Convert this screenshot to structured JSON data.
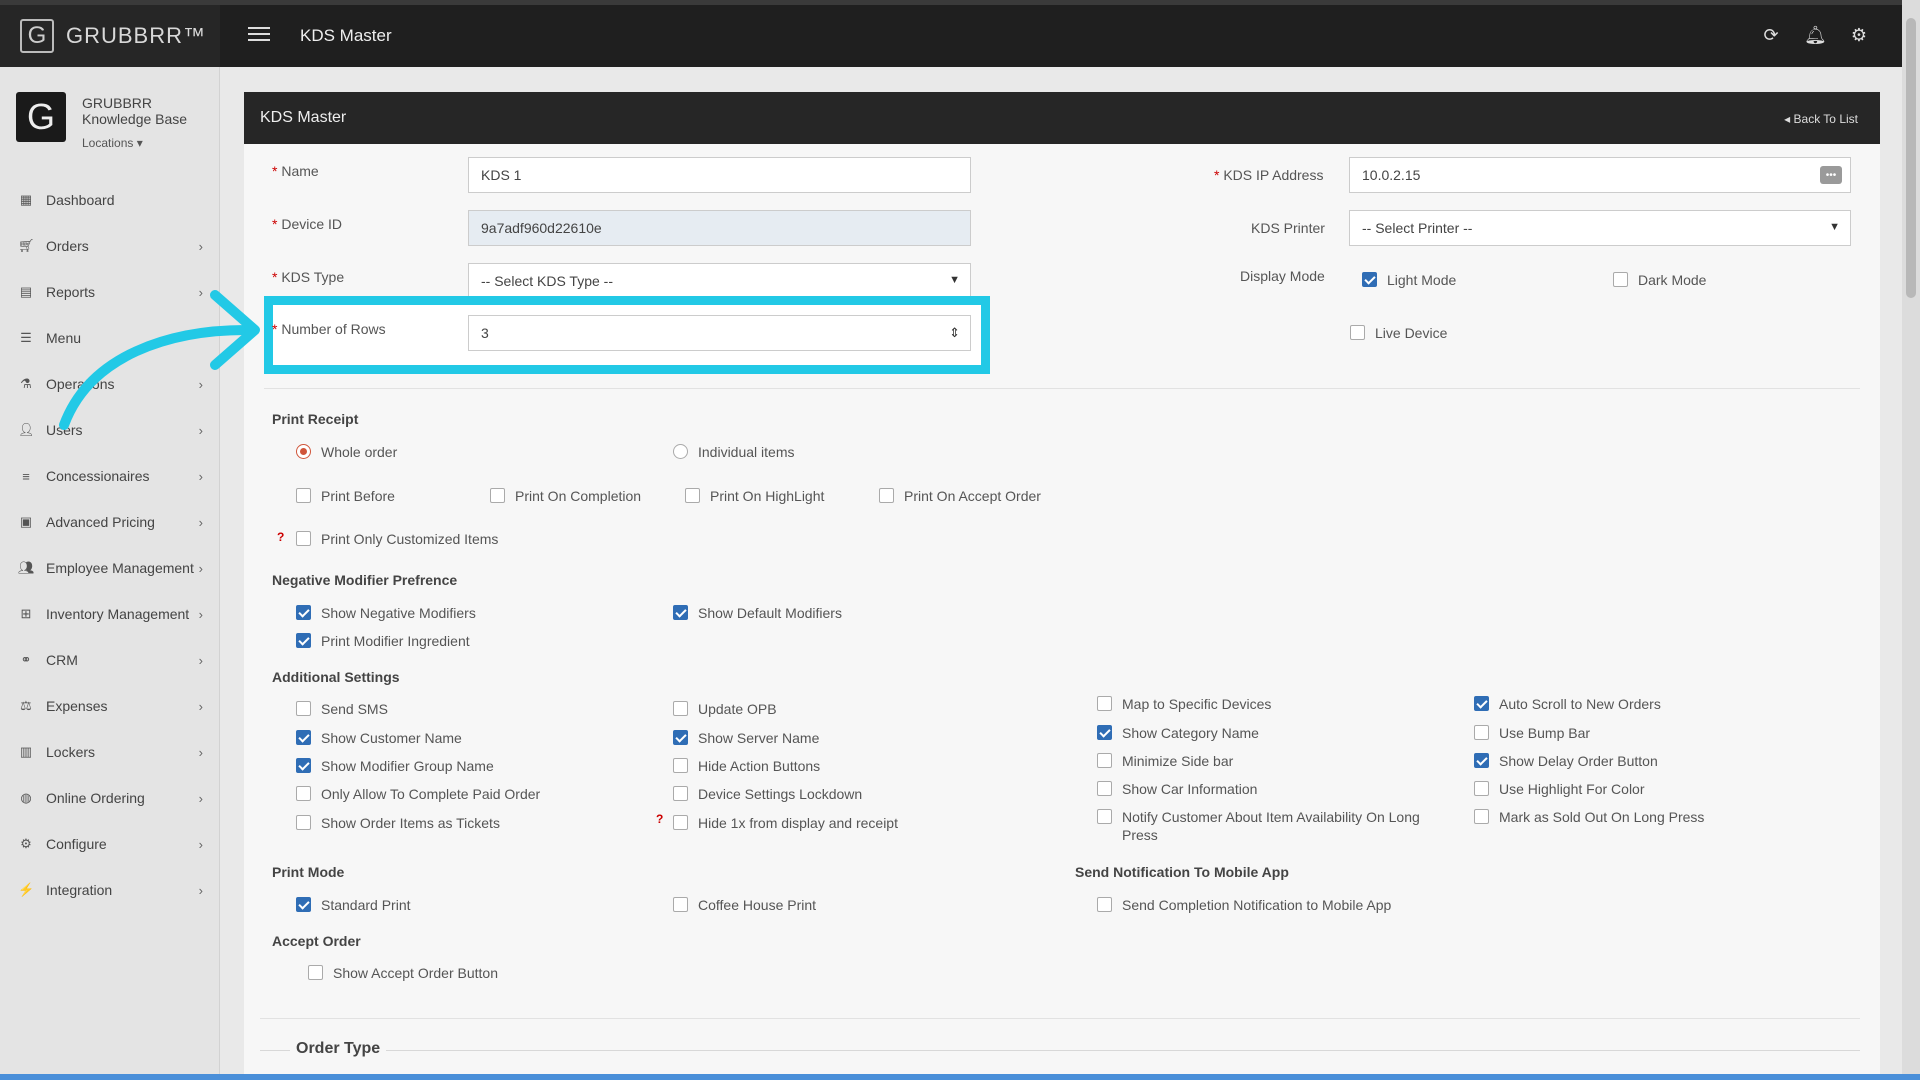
{
  "brand": {
    "logo_letter": "G",
    "name": "GRUBBRR™"
  },
  "header": {
    "title": "KDS Master"
  },
  "sidebar": {
    "profile_name": "GRUBBRR Knowledge Base",
    "profile_initial": "G",
    "locations": "Locations",
    "items": [
      {
        "label": "Dashboard",
        "icon": "dashboard-icon"
      },
      {
        "label": "Orders",
        "icon": "cart-icon"
      },
      {
        "label": "Reports",
        "icon": "report-icon"
      },
      {
        "label": "Menu",
        "icon": "menu-icon"
      },
      {
        "label": "Operations",
        "icon": "flask-icon"
      },
      {
        "label": "Users",
        "icon": "users-icon"
      },
      {
        "label": "Concessionaires",
        "icon": "list-icon"
      },
      {
        "label": "Advanced Pricing",
        "icon": "pricing-icon"
      },
      {
        "label": "Employee Management",
        "icon": "group-icon"
      },
      {
        "label": "Inventory Management",
        "icon": "sitemap-icon"
      },
      {
        "label": "CRM",
        "icon": "link-icon"
      },
      {
        "label": "Expenses",
        "icon": "scale-icon"
      },
      {
        "label": "Lockers",
        "icon": "lockers-icon"
      },
      {
        "label": "Online Ordering",
        "icon": "globe-icon"
      },
      {
        "label": "Configure",
        "icon": "gear-icon"
      },
      {
        "label": "Integration",
        "icon": "integration-icon"
      }
    ]
  },
  "panel": {
    "title": "KDS Master",
    "back_label": "Back To List"
  },
  "form": {
    "name_label": "Name",
    "name_value": "KDS 1",
    "device_id_label": "Device ID",
    "device_id_value": "9a7adf960d22610e",
    "kds_type_label": "KDS Type",
    "kds_type_value": "-- Select KDS Type --",
    "rows_label": "Number of Rows",
    "rows_value": "3",
    "ip_label": "KDS IP Address",
    "ip_value": "10.0.2.15",
    "printer_label": "KDS Printer",
    "printer_value": "-- Select Printer --",
    "display_mode_label": "Display Mode",
    "light_mode": "Light Mode",
    "dark_mode": "Dark Mode",
    "live_device": "Live Device"
  },
  "print_receipt": {
    "title": "Print Receipt",
    "whole_order": "Whole order",
    "individual_items": "Individual items",
    "print_before": "Print Before",
    "print_on_completion": "Print On Completion",
    "print_on_highlight": "Print On HighLight",
    "print_on_accept": "Print On Accept Order",
    "print_only_customized": "Print Only Customized Items"
  },
  "negative_modifier": {
    "title": "Negative Modifier Prefrence",
    "show_negative": "Show Negative Modifiers",
    "show_default": "Show Default Modifiers",
    "print_ingredient": "Print Modifier Ingredient"
  },
  "additional": {
    "title": "Additional Settings",
    "send_sms": "Send SMS",
    "update_opb": "Update OPB",
    "map_devices": "Map to Specific Devices",
    "auto_scroll": "Auto Scroll to New Orders",
    "show_customer": "Show Customer Name",
    "show_server": "Show Server Name",
    "show_category": "Show Category Name",
    "bump_bar": "Use Bump Bar",
    "show_modifier_group": "Show Modifier Group Name",
    "hide_action": "Hide Action Buttons",
    "minimize_side": "Minimize Side bar",
    "show_delay": "Show Delay Order Button",
    "only_paid": "Only Allow To Complete Paid Order",
    "device_lockdown": "Device Settings Lockdown",
    "show_car": "Show Car Information",
    "highlight_color": "Use Highlight For Color",
    "order_tickets": "Show Order Items as Tickets",
    "hide_1x": "Hide 1x from display and receipt",
    "notify_customer": "Notify Customer About Item Availability On Long Press",
    "sold_out": "Mark as Sold Out On Long Press"
  },
  "print_mode": {
    "title": "Print Mode",
    "standard": "Standard Print",
    "coffee": "Coffee House Print"
  },
  "notification": {
    "title": "Send Notification To Mobile App",
    "completion": "Send Completion Notification to Mobile App"
  },
  "accept_order": {
    "title": "Accept Order",
    "show_button": "Show Accept Order Button"
  },
  "order_type": {
    "title": "Order Type"
  }
}
